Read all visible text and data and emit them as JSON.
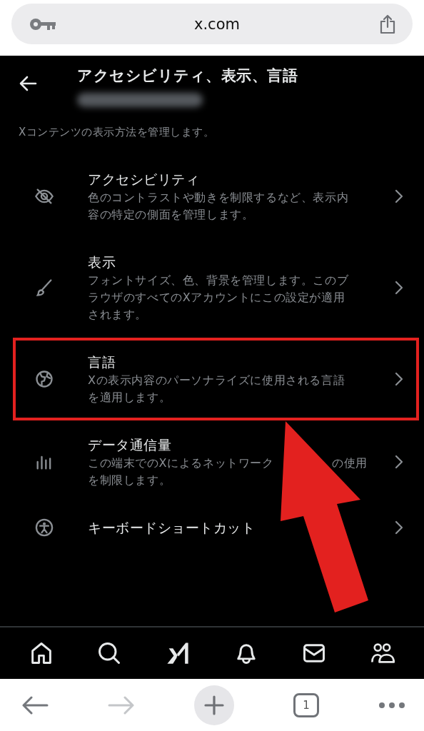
{
  "address_bar": {
    "url": "x.com"
  },
  "header": {
    "title": "アクセシビリティ、表示、言語"
  },
  "intro": "Xコンテンツの表示方法を管理します。",
  "items": [
    {
      "kind": "accessibility",
      "title": "アクセシビリティ",
      "description_lines": [
        [
          "色のコントラストや動きを制限するなど、表示内"
        ],
        [
          "容の特定の側面を管理します。"
        ]
      ],
      "highlighted": false
    },
    {
      "kind": "display",
      "title": "表示",
      "description_lines": [
        [
          "フォントサイズ、色、背景を管理します。このブ"
        ],
        [
          "ラウザのすべてのXアカウントにこの設定が適用"
        ],
        [
          "されます。"
        ]
      ],
      "highlighted": false
    },
    {
      "kind": "language",
      "title": "言語",
      "description_lines": [
        [
          "Xの表示内容のパーソナライズに使用される言語"
        ],
        [
          "を適用します。"
        ]
      ],
      "highlighted": true
    },
    {
      "kind": "data",
      "title": "データ通信量",
      "description_lines": [
        [
          "この端末でのXによるネットワーク",
          "の使用"
        ],
        [
          "を制限します。"
        ]
      ],
      "highlighted": false
    },
    {
      "kind": "keyboard",
      "title": "キーボードショートカット",
      "highlighted": false
    }
  ],
  "bottom_nav": [
    {
      "kind": "home"
    },
    {
      "kind": "search"
    },
    {
      "kind": "grok"
    },
    {
      "kind": "notifications"
    },
    {
      "kind": "messages"
    },
    {
      "kind": "communities"
    }
  ],
  "browser_bar": {
    "tab_count": "1",
    "forward_disabled": true
  }
}
